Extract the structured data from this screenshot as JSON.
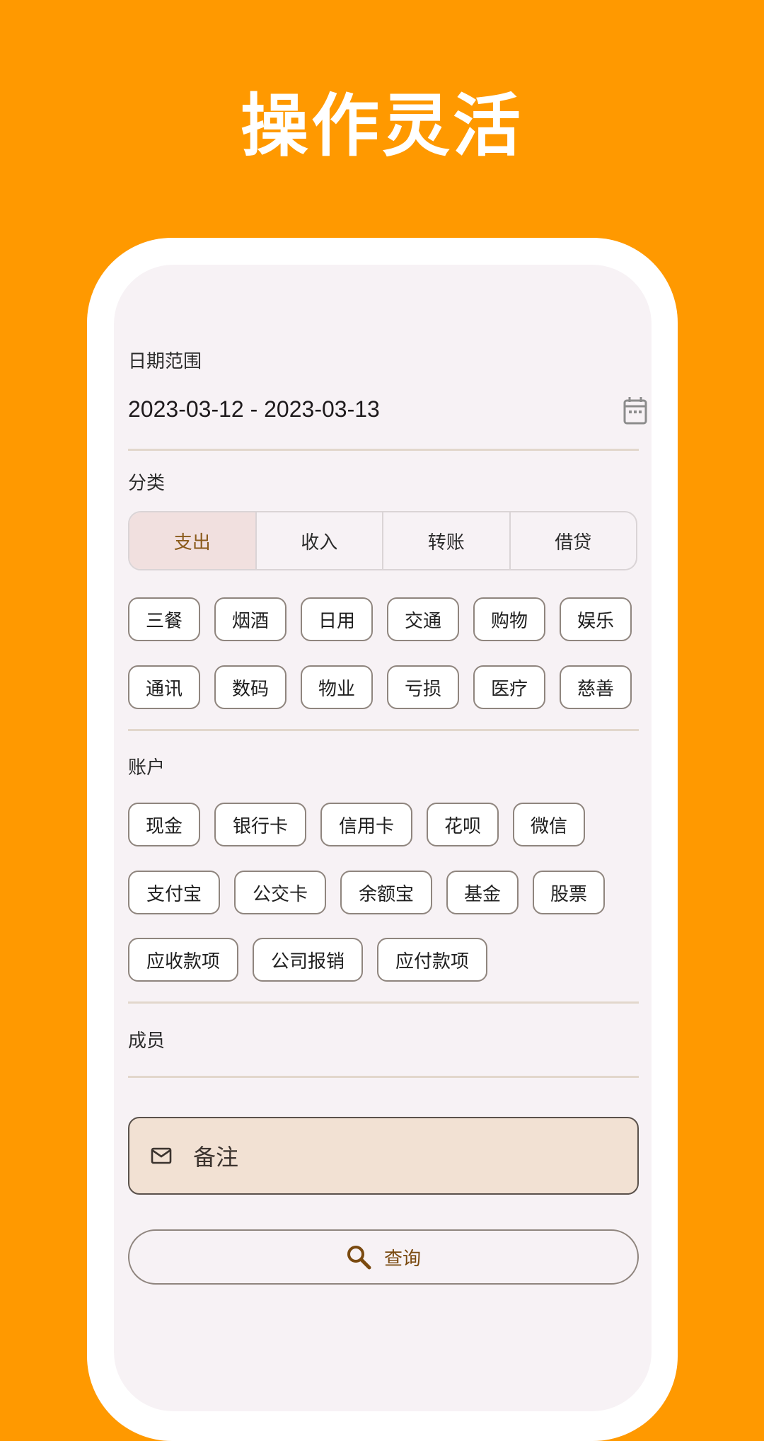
{
  "hero": {
    "title": "操作灵活"
  },
  "date": {
    "label": "日期范围",
    "value": "2023-03-12 - 2023-03-13"
  },
  "category": {
    "label": "分类",
    "segments": [
      "支出",
      "收入",
      "转账",
      "借贷"
    ],
    "selected": "支出",
    "chips": [
      "三餐",
      "烟酒",
      "日用",
      "交通",
      "购物",
      "娱乐",
      "通讯",
      "数码",
      "物业",
      "亏损",
      "医疗",
      "慈善"
    ]
  },
  "account": {
    "label": "账户",
    "chips": [
      "现金",
      "银行卡",
      "信用卡",
      "花呗",
      "微信",
      "支付宝",
      "公交卡",
      "余额宝",
      "基金",
      "股票",
      "应收款项",
      "公司报销",
      "应付款项"
    ]
  },
  "member": {
    "label": "成员"
  },
  "remark": {
    "placeholder": "备注"
  },
  "query": {
    "label": "查询"
  },
  "colors": {
    "background": "#FF9900",
    "screen": "#F7F2F5",
    "accent_text": "#7A4A10",
    "remark_fill": "#F2E1D3"
  }
}
